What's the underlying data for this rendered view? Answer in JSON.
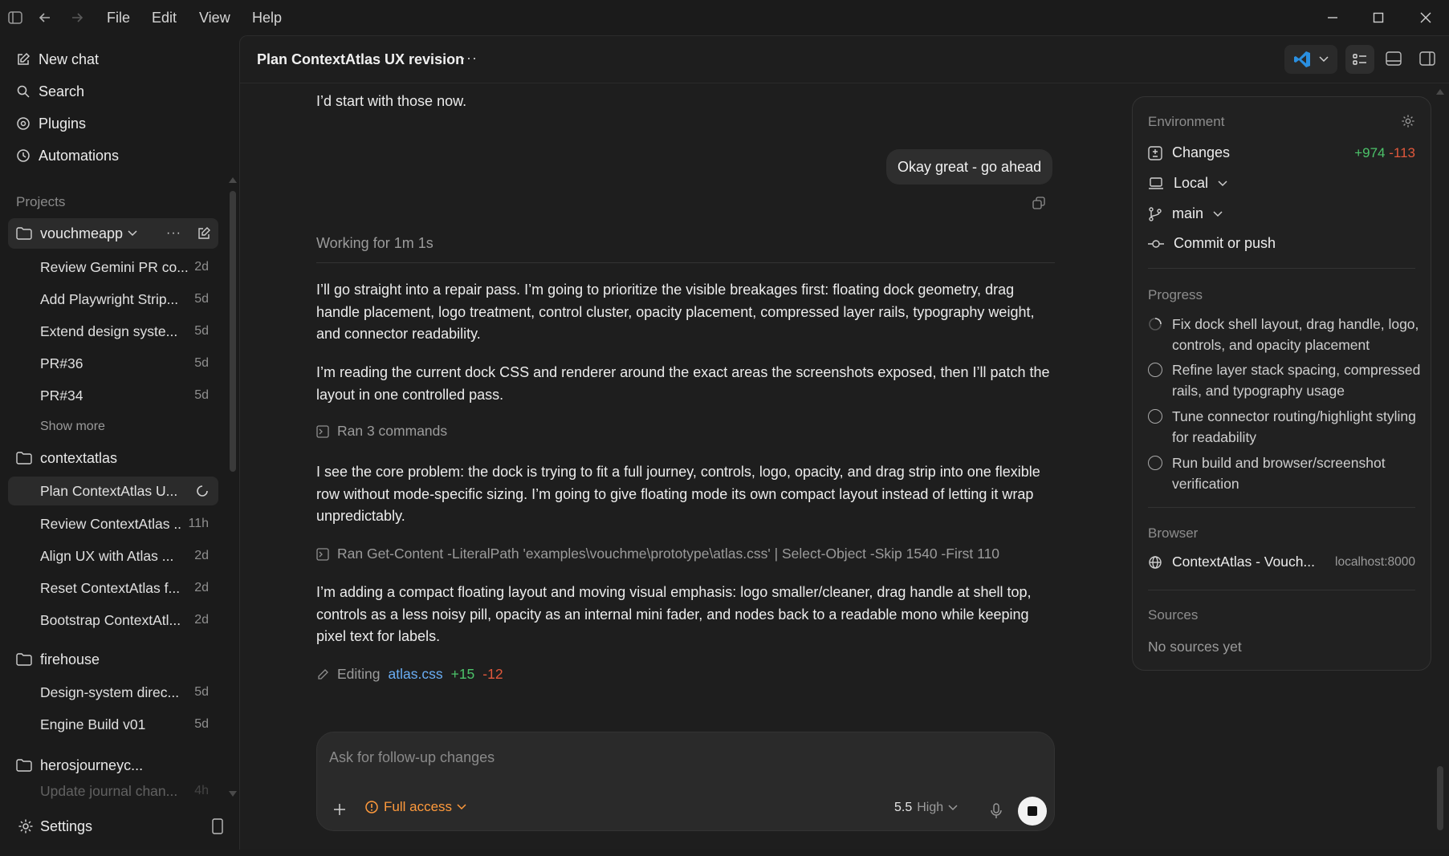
{
  "menu": [
    "File",
    "Edit",
    "View",
    "Help"
  ],
  "sidebar": {
    "nav": [
      {
        "label": "New chat",
        "icon": "compose-icon"
      },
      {
        "label": "Search",
        "icon": "search-icon"
      },
      {
        "label": "Plugins",
        "icon": "plugin-icon"
      },
      {
        "label": "Automations",
        "icon": "clock-icon"
      }
    ],
    "projects_label": "Projects",
    "projects": [
      {
        "name": "vouchmeapp",
        "threads": [
          {
            "title": "Review Gemini PR co...",
            "age": "2d"
          },
          {
            "title": "Add Playwright Strip...",
            "age": "5d"
          },
          {
            "title": "Extend design syste...",
            "age": "5d"
          },
          {
            "title": "PR#36",
            "age": "5d"
          },
          {
            "title": "PR#34",
            "age": "5d"
          }
        ],
        "show_more": "Show more"
      },
      {
        "name": "contextatlas",
        "threads": [
          {
            "title": "Plan ContextAtlas U...",
            "age": ""
          },
          {
            "title": "Review ContextAtlas ...",
            "age": "11h"
          },
          {
            "title": "Align UX with Atlas ...",
            "age": "2d"
          },
          {
            "title": "Reset ContextAtlas f...",
            "age": "2d"
          },
          {
            "title": "Bootstrap ContextAtl...",
            "age": "2d"
          }
        ]
      },
      {
        "name": "firehouse",
        "threads": [
          {
            "title": "Design-system direc...",
            "age": "5d"
          },
          {
            "title": "Engine Build v01",
            "age": "5d"
          }
        ]
      },
      {
        "name": "herosjourneyc...",
        "threads": [
          {
            "title": "Update journal chan...",
            "age": "4h"
          }
        ]
      }
    ],
    "settings_label": "Settings"
  },
  "header": {
    "title": "Plan ContextAtlas UX revision",
    "more": "···"
  },
  "chat": {
    "prev_tail": "I’d start with those now.",
    "user_message": "Okay great - go ahead",
    "working": "Working for 1m 1s",
    "p1": "I’ll go straight into a repair pass. I’m going to prioritize the visible breakages first: floating dock geometry, drag handle placement, logo treatment, control cluster, opacity placement, compressed layer rails, typography weight, and connector readability.",
    "p2": "I’m reading the current dock CSS and renderer around the exact areas the screenshots exposed, then I’ll patch the layout in one controlled pass.",
    "cmd1": "Ran 3 commands",
    "p3": "I see the core problem: the dock is trying to fit a full journey, controls, logo, opacity, and drag strip into one flexible row without mode-specific sizing. I’m going to give floating mode its own compact layout instead of letting it wrap unpredictably.",
    "cmd2": "Ran Get-Content -LiteralPath 'examples\\vouchme\\prototype\\atlas.css' | Select-Object -Skip 1540 -First 110",
    "p4": "I’m adding a compact floating layout and moving visual emphasis: logo smaller/cleaner, drag handle at shell top, controls as a less noisy pill, opacity as an internal mini fader, and nodes back to a readable mono while keeping pixel text for labels.",
    "editing_label": "Editing",
    "editing_file": "atlas.css",
    "editing_add": "+15",
    "editing_del": "-12"
  },
  "composer": {
    "placeholder": "Ask for follow-up changes",
    "access": "Full access",
    "model": "5.5",
    "effort": "High"
  },
  "panel": {
    "environment_label": "Environment",
    "changes_label": "Changes",
    "changes_add": "+974",
    "changes_del": "-113",
    "local_label": "Local",
    "branch_label": "main",
    "commit_label": "Commit or push",
    "progress_label": "Progress",
    "progress": [
      {
        "text": "Fix dock shell layout, drag handle, logo, controls, and opacity placement",
        "status": "in-progress"
      },
      {
        "text": "Refine layer stack spacing, compressed rails, and typography usage",
        "status": "pending"
      },
      {
        "text": "Tune connector routing/highlight styling for readability",
        "status": "pending"
      },
      {
        "text": "Run build and browser/screenshot verification",
        "status": "pending"
      }
    ],
    "browser_label": "Browser",
    "browser_title": "ContextAtlas - Vouch...",
    "browser_url": "localhost:8000",
    "sources_label": "Sources",
    "sources_empty": "No sources yet"
  },
  "colors": {
    "accent_orange": "#ff9a3c",
    "add_green": "#4cc36a",
    "del_red": "#e0583c",
    "link_blue": "#6aaef5"
  }
}
